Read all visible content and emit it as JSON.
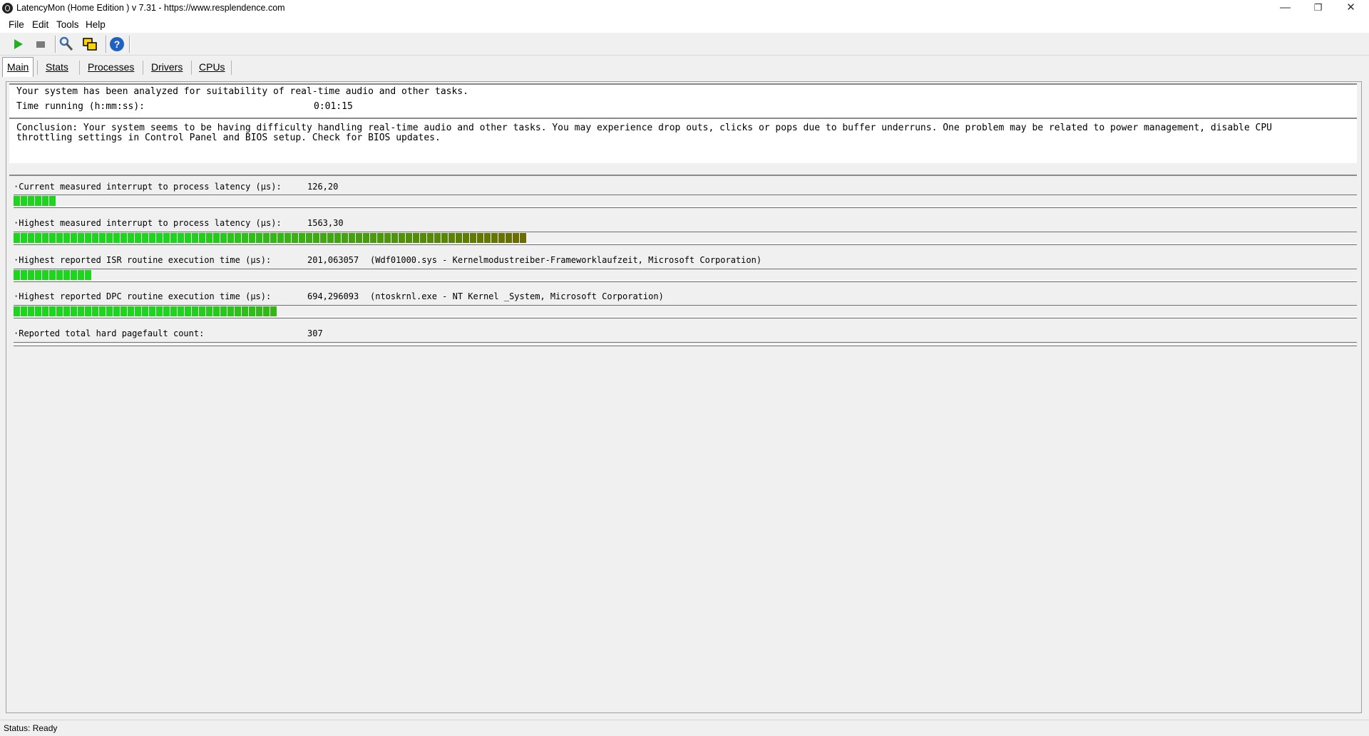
{
  "window": {
    "title": "LatencyMon  (Home Edition )  v 7.31 - https://www.resplendence.com",
    "minimize": "—",
    "restore": "❐",
    "close": "✕"
  },
  "menu": [
    {
      "label": "File"
    },
    {
      "label": "Edit"
    },
    {
      "label": "Tools"
    },
    {
      "label": "Help"
    }
  ],
  "toolbar": {
    "icons": [
      "play-icon",
      "stop-icon",
      "wrench-icon",
      "windows-icon",
      "help-icon"
    ],
    "colors": {
      "play": "#22b022",
      "stop": "#7a7a7a",
      "help": "#2060c0"
    }
  },
  "tabs": [
    {
      "label": "Main",
      "active": true
    },
    {
      "label": "Stats",
      "active": false
    },
    {
      "label": "Processes",
      "active": false
    },
    {
      "label": "Drivers",
      "active": false
    },
    {
      "label": "CPUs",
      "active": false
    }
  ],
  "main": {
    "analysis_line": "Your system has been analyzed for suitability of real-time audio and other tasks.",
    "time_label": "Time running (h:mm:ss):",
    "time_value": "0:01:15",
    "conclusion_line1": "Conclusion: Your system seems to be having difficulty handling real-time audio and other tasks. You may experience drop outs, clicks or pops due to buffer underruns. One problem may be related to power management, disable CPU",
    "conclusion_line2": "throttling settings in Control Panel and BIOS setup. Check for BIOS updates."
  },
  "metrics": [
    {
      "label": "·Current measured interrupt to process latency (µs):",
      "value": "126,20",
      "detail": "",
      "bar_fraction": 0.034,
      "bar_visible": true
    },
    {
      "label": "·Highest measured interrupt to process latency (µs):",
      "value": "1563,30",
      "detail": "",
      "bar_fraction": 0.382,
      "bar_visible": true
    },
    {
      "label": "·Highest reported ISR routine execution time (µs):",
      "value": "201,063057",
      "detail": "(Wdf01000.sys - Kernelmodustreiber-Frameworklaufzeit, Microsoft Corporation)",
      "bar_fraction": 0.057,
      "bar_visible": true
    },
    {
      "label": "·Highest reported DPC routine execution time (µs):",
      "value": "694,296093",
      "detail": "(ntoskrnl.exe - NT Kernel _System, Microsoft Corporation)",
      "bar_fraction": 0.197,
      "bar_visible": true
    },
    {
      "label": "·Reported total hard pagefault count:",
      "value": "307",
      "detail": "",
      "bar_fraction": 0,
      "bar_visible": false
    }
  ],
  "bar_colors": {
    "green": "#1fd41f",
    "olive": "#6b6b00"
  },
  "status": {
    "text": "Status: Ready"
  }
}
